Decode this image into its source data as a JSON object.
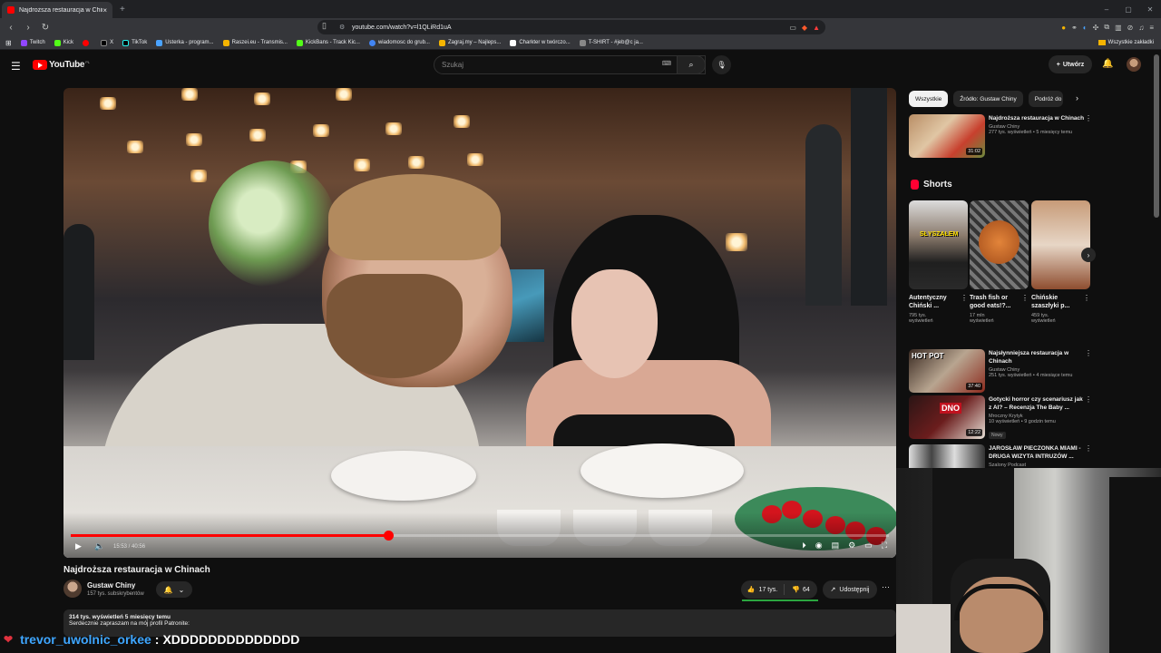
{
  "browser": {
    "tab_title": "Najdroższa restauracja w Chinach",
    "tab_close": "×",
    "new_tab": "+",
    "window_controls": [
      "–",
      "▢",
      "✕"
    ],
    "url": "youtube.com/watch?v=l1QLiRd1uA",
    "bookmarks": [
      {
        "label": "Twitch",
        "color": "#9146ff"
      },
      {
        "label": "Kick",
        "color": "#53fc18"
      },
      {
        "label": "",
        "color": "#ff0000"
      },
      {
        "label": "X",
        "color": "#e8eaed"
      },
      {
        "label": "TikTok",
        "color": "#ffffff"
      },
      {
        "label": "Usterka - program...",
        "color": "#4aa3ff"
      },
      {
        "label": "Raszei.eu - Transmis...",
        "color": "#f5b400"
      },
      {
        "label": "KickBans - Track Kic...",
        "color": "#53fc18"
      },
      {
        "label": "wiadomosc do grub...",
        "color": "#4285f4"
      },
      {
        "label": "Zagraj.my – Najleps...",
        "color": "#f4b400"
      },
      {
        "label": "Charkter w twórczo...",
        "color": "#ffffff"
      },
      {
        "label": "T-SHIRT - #jeb@c ja...",
        "color": "#888888"
      }
    ],
    "all_bookmarks": "Wszystkie zakładki"
  },
  "youtube": {
    "logo_text": "YouTube",
    "logo_country": "PL",
    "search_placeholder": "Szukaj",
    "create_label": "Utwórz",
    "player": {
      "current_time": "15:53",
      "duration": "40:56",
      "progress": 0.388
    },
    "video": {
      "title": "Najdroższa restauracja w Chinach",
      "channel": "Gustaw Chiny",
      "subscribers": "157 tys. subskrybentów",
      "likes": "17 tys.",
      "dislikes": "64",
      "share_label": "Udostępnij",
      "views_age": "314 tys. wyświetleń  5 miesięcy temu",
      "description": "Serdecznie zapraszam na mój profil Patronite:"
    },
    "chips": [
      "Wszystkie",
      "Źródło: Gustaw Chiny",
      "Podróż do"
    ],
    "recommended_top": {
      "title": "Najdroższa restauracja w Chinach",
      "channel": "Gustaw Chiny",
      "meta": "277 tys. wyświetleń • 5 miesięcy temu",
      "duration": "31:02"
    },
    "shorts_heading": "Shorts",
    "shorts": [
      {
        "title": "Autentyczny Chiński ...",
        "views": "795 tys. wyświetleń",
        "overlay": "SŁYSZAŁEM"
      },
      {
        "title": "Trash fish or good eats!?...",
        "views": "17 mln wyświetleń",
        "overlay": ""
      },
      {
        "title": "Chińskie szaszłyki p...",
        "views": "459 tys. wyświetleń",
        "overlay": ""
      }
    ],
    "recommended": [
      {
        "title": "Najsłynniejsza restauracja w Chinach",
        "channel": "Gustaw Chiny",
        "meta": "251 tys. wyświetleń • 4 miesiące temu",
        "duration": "37:40",
        "badge": "",
        "overlay": "HOT POT"
      },
      {
        "title": "Gotycki horror czy scenariusz jak z AI? – Recenzja The Baby ...",
        "channel": "Mroczny Krytyk",
        "meta": "10 wyświetleń • 9 godzin temu",
        "duration": "12:22",
        "badge": "Nowy",
        "overlay": "DNO"
      },
      {
        "title": "JAROSŁAW PIECZONKA MIAMI - DRUGA WIZYTA INTRUZÓW ...",
        "channel": "Szalony Podcast",
        "meta": "",
        "duration": "",
        "badge": "",
        "overlay": ""
      }
    ]
  },
  "chat": {
    "username": "trevor_uwolnic_orkee",
    "separator": ":",
    "message": "XDDDDDDDDDDDDDD"
  }
}
